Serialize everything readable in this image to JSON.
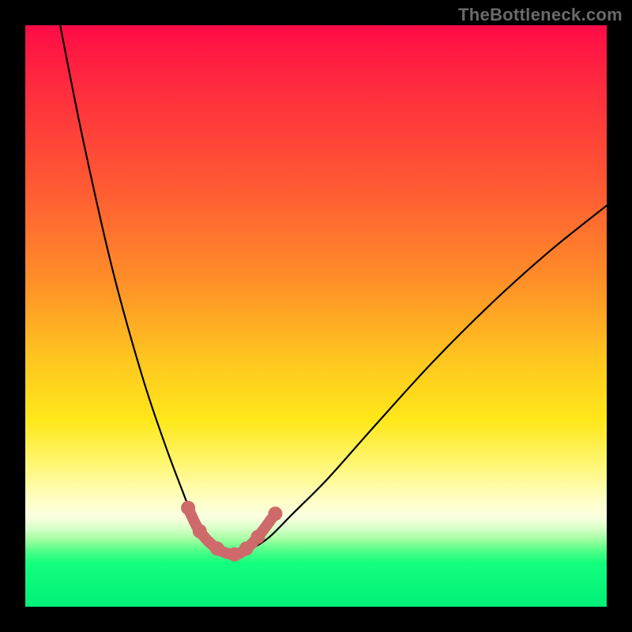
{
  "watermark": "TheBottleneck.com",
  "colors": {
    "frame_bg": "#000000",
    "watermark": "#6a6a6a",
    "curve": "#000000",
    "marker": "#cf6a6a",
    "gradient_stops": [
      {
        "pos": 0.0,
        "color": "#ff0b47"
      },
      {
        "pos": 0.1,
        "color": "#ff2a3f"
      },
      {
        "pos": 0.28,
        "color": "#ff5a33"
      },
      {
        "pos": 0.44,
        "color": "#ff8f28"
      },
      {
        "pos": 0.58,
        "color": "#ffc81f"
      },
      {
        "pos": 0.68,
        "color": "#ffe81a"
      },
      {
        "pos": 0.76,
        "color": "#fff77a"
      },
      {
        "pos": 0.815,
        "color": "#ffffc4"
      },
      {
        "pos": 0.845,
        "color": "#fbffe0"
      },
      {
        "pos": 0.865,
        "color": "#d9ffc8"
      },
      {
        "pos": 0.885,
        "color": "#9effa0"
      },
      {
        "pos": 0.905,
        "color": "#4dff87"
      },
      {
        "pos": 0.925,
        "color": "#13ff7e"
      },
      {
        "pos": 1.0,
        "color": "#00ef78"
      }
    ]
  },
  "chart_data": {
    "type": "line",
    "title": "",
    "xlabel": "",
    "ylabel": "",
    "xlim": [
      0,
      100
    ],
    "ylim": [
      0,
      100
    ],
    "series": [
      {
        "name": "bottleneck-curve",
        "x": [
          6,
          10,
          15,
          20,
          24,
          27,
          29,
          31,
          33,
          35,
          37,
          39,
          42,
          46,
          52,
          60,
          70,
          80,
          90,
          100
        ],
        "y": [
          100,
          80,
          58,
          40,
          28,
          20,
          15,
          12,
          10,
          9,
          9,
          10,
          12,
          16,
          22,
          31,
          42,
          52,
          61,
          69
        ]
      }
    ],
    "markers": {
      "name": "optimal-range",
      "x": [
        28,
        30,
        33,
        36,
        38,
        40,
        43
      ],
      "y": [
        17,
        13,
        10,
        9,
        10,
        12,
        16
      ]
    },
    "annotations": []
  }
}
